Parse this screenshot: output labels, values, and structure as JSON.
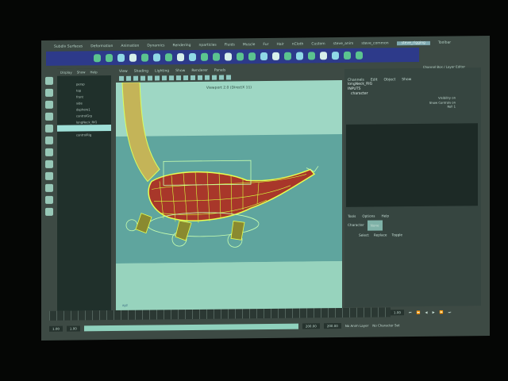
{
  "menubar": {
    "items": [
      "Subdiv Surfaces",
      "Deformation",
      "Animation",
      "Dynamics",
      "Rendering",
      "nparticles",
      "Fluids",
      "Muscle",
      "Fur",
      "Hair",
      "nCloth",
      "Custom",
      "steve_anim",
      "steve_common",
      "steve_rigging",
      "Toolbar"
    ]
  },
  "outliner": {
    "menu": [
      "Display",
      "Show",
      "Help"
    ],
    "items": [
      "persp",
      "top",
      "front",
      "side",
      "dsphere1",
      "controlGrp",
      "longNeck_RIG",
      "",
      "controlRig"
    ],
    "selected_index": 7
  },
  "viewport": {
    "menu": [
      "View",
      "Shading",
      "Lighting",
      "Show",
      "Renderer",
      "Panels"
    ],
    "label": "Viewport 2.0 (DirectX 11)",
    "camera": "persp"
  },
  "channel_box": {
    "title": "Channel Box / Layer Editor",
    "menu": [
      "Channels",
      "Edit",
      "Object",
      "Show"
    ],
    "object": "longNeck_RIG",
    "inputs": "INPUTS",
    "input_node": "character",
    "attributes": [
      "Visibility on",
      "Show Controls on",
      "Roll 1"
    ],
    "layer_menu": [
      "Tools",
      "Options",
      "Help"
    ],
    "character_label": "Character",
    "character_value": "None",
    "select_label": "Select",
    "replace_label": "Replace",
    "toggle_label": "Toggle"
  },
  "range": {
    "start": "1.00",
    "current": "1.00",
    "end": "200.00",
    "end2": "200.00",
    "frame": "1.00",
    "anim_layer": "No Anim Layer",
    "character_set": "No Character Set"
  }
}
